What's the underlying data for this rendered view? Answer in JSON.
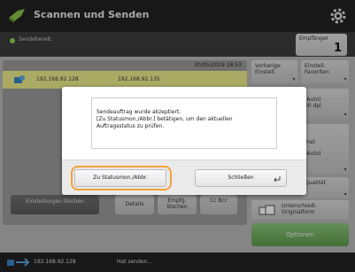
{
  "header": {
    "title": "Scannen und Senden",
    "app_icon": "scan-send-icon",
    "settings_icon": "gear-icon"
  },
  "status": {
    "text": "Sendebereit.",
    "recipients_label": "Empfänger",
    "recipients_count": "1"
  },
  "job_list": {
    "date": "30/05/2019 18:53",
    "row": {
      "address1": "192.168.92.128",
      "address2": "192.168.92.135"
    }
  },
  "list_buttons": {
    "cancel": "Einstellungen löschen",
    "details": "Details",
    "clear_recipients": "Empfg. löschen",
    "cc_bcc": "Cc Bcc"
  },
  "right_panel": {
    "favorites_call": "Vorherige Einstell.",
    "favorites": "Einstell. Favoriten",
    "res": "(Auto)",
    "dpi": "00 dpi",
    "mat": "mat",
    "print": "(Auto)",
    "quality": "Qualität",
    "duplex": "Unterschiedl. Originalform",
    "options": "Optionen"
  },
  "dialog": {
    "lines": [
      "Sendeauftrag wurde akzeptiert.",
      "[Zu Statusmon./Abbr.] betätigen, um den aktuellen",
      "Auftragsstatus zu prüfen."
    ],
    "status_button": "Zu Statusmon./Abbr.",
    "close_button": "Schließen"
  },
  "footer": {
    "ip": "192.168.92.128",
    "message": "Hat senden..."
  },
  "colors": {
    "highlight": "#f2a23a",
    "green": "#6aa656",
    "selected_row": "#ecec8c"
  }
}
